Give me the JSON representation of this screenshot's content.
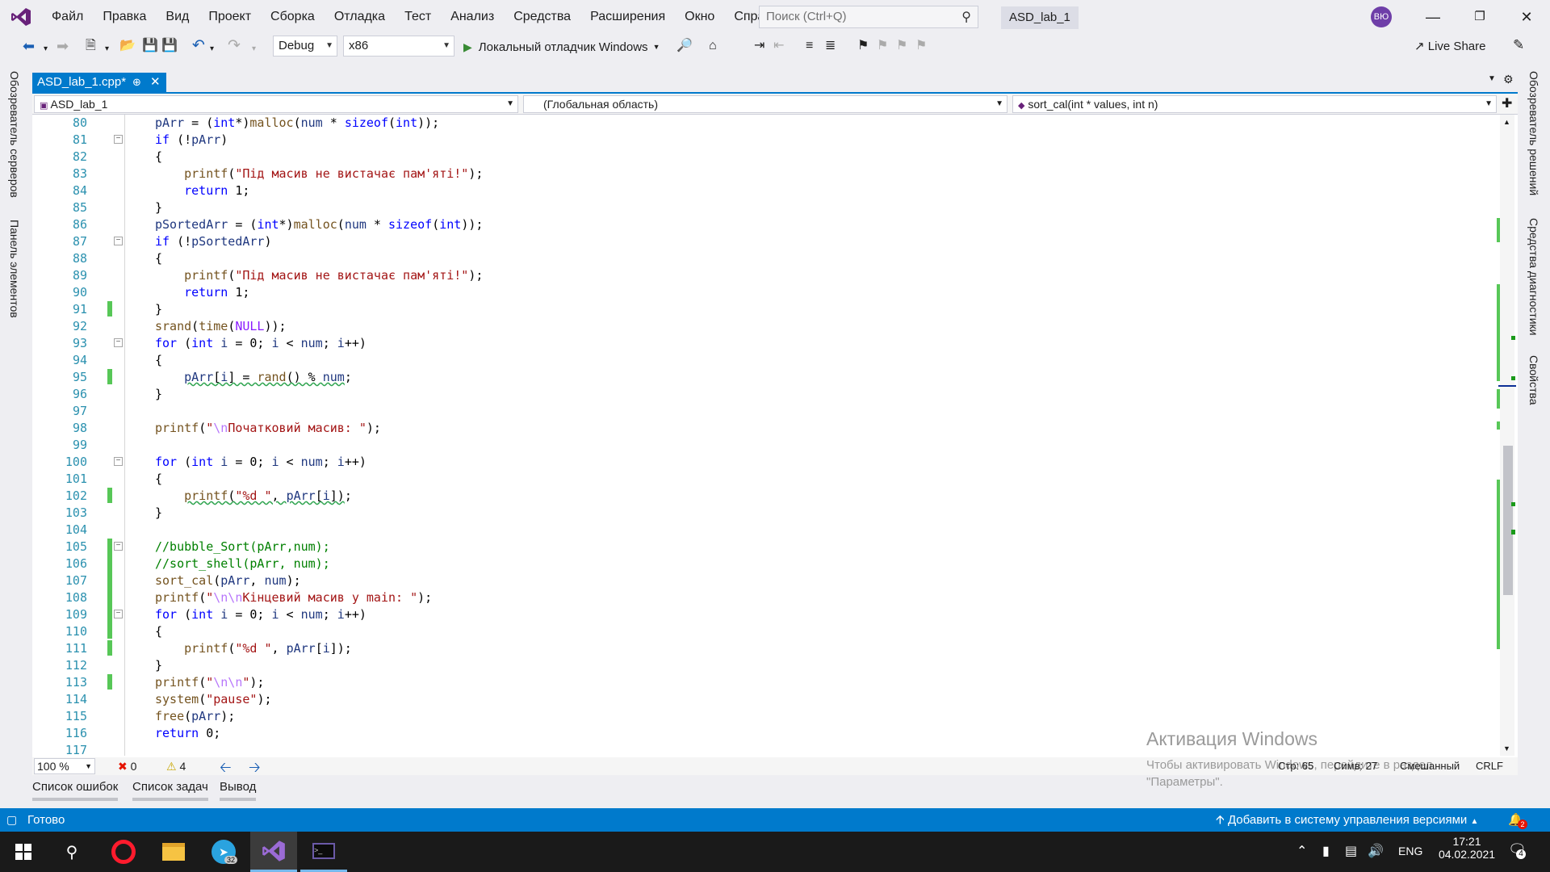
{
  "menubar": {
    "items": [
      "Файл",
      "Правка",
      "Вид",
      "Проект",
      "Сборка",
      "Отладка",
      "Тест",
      "Анализ",
      "Средства",
      "Расширения",
      "Окно",
      "Справка"
    ],
    "search_placeholder": "Поиск (Ctrl+Q)",
    "solution_title": "ASD_lab_1",
    "avatar_initials": "ВЮ"
  },
  "toolbar": {
    "config": "Debug",
    "platform": "x86",
    "run_label": "Локальный отладчик Windows",
    "liveshare": "Live Share"
  },
  "side_tabs": {
    "left": [
      "Обозреватель серверов",
      "Панель элементов"
    ],
    "right": [
      "Обозреватель решений",
      "Средства диагностики",
      "Свойства"
    ]
  },
  "document_tab": {
    "label": "ASD_lab_1.cpp*"
  },
  "navbar": {
    "project": "ASD_lab_1",
    "scope": "(Глобальная область)",
    "member": "sort_cal(int * values, int n)"
  },
  "editor": {
    "lines": [
      {
        "n": "80",
        "code": "pArr = (int*)malloc(num * sizeof(int));"
      },
      {
        "n": "81",
        "code": "if (!pArr)"
      },
      {
        "n": "82",
        "code": "{"
      },
      {
        "n": "83",
        "code": "printf(\"Під масив не вистачає пам'яті!\");"
      },
      {
        "n": "84",
        "code": "return 1;"
      },
      {
        "n": "85",
        "code": "}"
      },
      {
        "n": "86",
        "code": "pSortedArr = (int*)malloc(num * sizeof(int));"
      },
      {
        "n": "87",
        "code": "if (!pSortedArr)"
      },
      {
        "n": "88",
        "code": "{"
      },
      {
        "n": "89",
        "code": "printf(\"Під масив не вистачає пам'яті!\");"
      },
      {
        "n": "90",
        "code": "return 1;"
      },
      {
        "n": "91",
        "code": "}"
      },
      {
        "n": "92",
        "code": "srand(time(NULL));"
      },
      {
        "n": "93",
        "code": "for (int i = 0; i < num; i++)"
      },
      {
        "n": "94",
        "code": "{"
      },
      {
        "n": "95",
        "code": "pArr[i] = rand() % num;"
      },
      {
        "n": "96",
        "code": "}"
      },
      {
        "n": "97",
        "code": ""
      },
      {
        "n": "98",
        "code": "printf(\"\\nПочатковий масив: \");"
      },
      {
        "n": "99",
        "code": ""
      },
      {
        "n": "100",
        "code": "for (int i = 0; i < num; i++)"
      },
      {
        "n": "101",
        "code": "{"
      },
      {
        "n": "102",
        "code": "printf(\"%d \", pArr[i]);"
      },
      {
        "n": "103",
        "code": "}"
      },
      {
        "n": "104",
        "code": ""
      },
      {
        "n": "105",
        "code": "//bubble_Sort(pArr,num);"
      },
      {
        "n": "106",
        "code": "//sort_shell(pArr, num);"
      },
      {
        "n": "107",
        "code": "sort_cal(pArr, num);"
      },
      {
        "n": "108",
        "code": "printf(\"\\n\\nКінцевий масив у main: \");"
      },
      {
        "n": "109",
        "code": "for (int i = 0; i < num; i++)"
      },
      {
        "n": "110",
        "code": "{"
      },
      {
        "n": "111",
        "code": "printf(\"%d \", pArr[i]);"
      },
      {
        "n": "112",
        "code": "}"
      },
      {
        "n": "113",
        "code": "printf(\"\\n\\n\");"
      },
      {
        "n": "114",
        "code": "system(\"pause\");"
      },
      {
        "n": "115",
        "code": "free(pArr);"
      },
      {
        "n": "116",
        "code": "return 0;"
      },
      {
        "n": "117",
        "code": "}"
      }
    ]
  },
  "editor_status": {
    "zoom": "100 %",
    "errors": "0",
    "warnings": "4",
    "line": "Стр: 65",
    "col": "Симв: 27",
    "tabs": "Смешанный",
    "eol": "CRLF"
  },
  "activation": {
    "title": "Активация Windows",
    "line1": "Чтобы активировать Windows, перейдите в раздел",
    "line2": "\"Параметры\"."
  },
  "bottom_tabs": [
    "Список ошибок",
    "Список задач",
    "Вывод"
  ],
  "statusbar": {
    "ready": "Готово",
    "source_control": "Добавить в систему управления версиями",
    "notif_count": "2"
  },
  "taskbar": {
    "telegram_badge": "32",
    "lang": "ENG",
    "time": "17:21",
    "date": "04.02.2021",
    "notif_count": "4"
  },
  "colors": {
    "accent": "#007acc",
    "vs_purple": "#68217a",
    "keyword": "#0000ff",
    "string": "#a31515",
    "comment": "#008000"
  }
}
